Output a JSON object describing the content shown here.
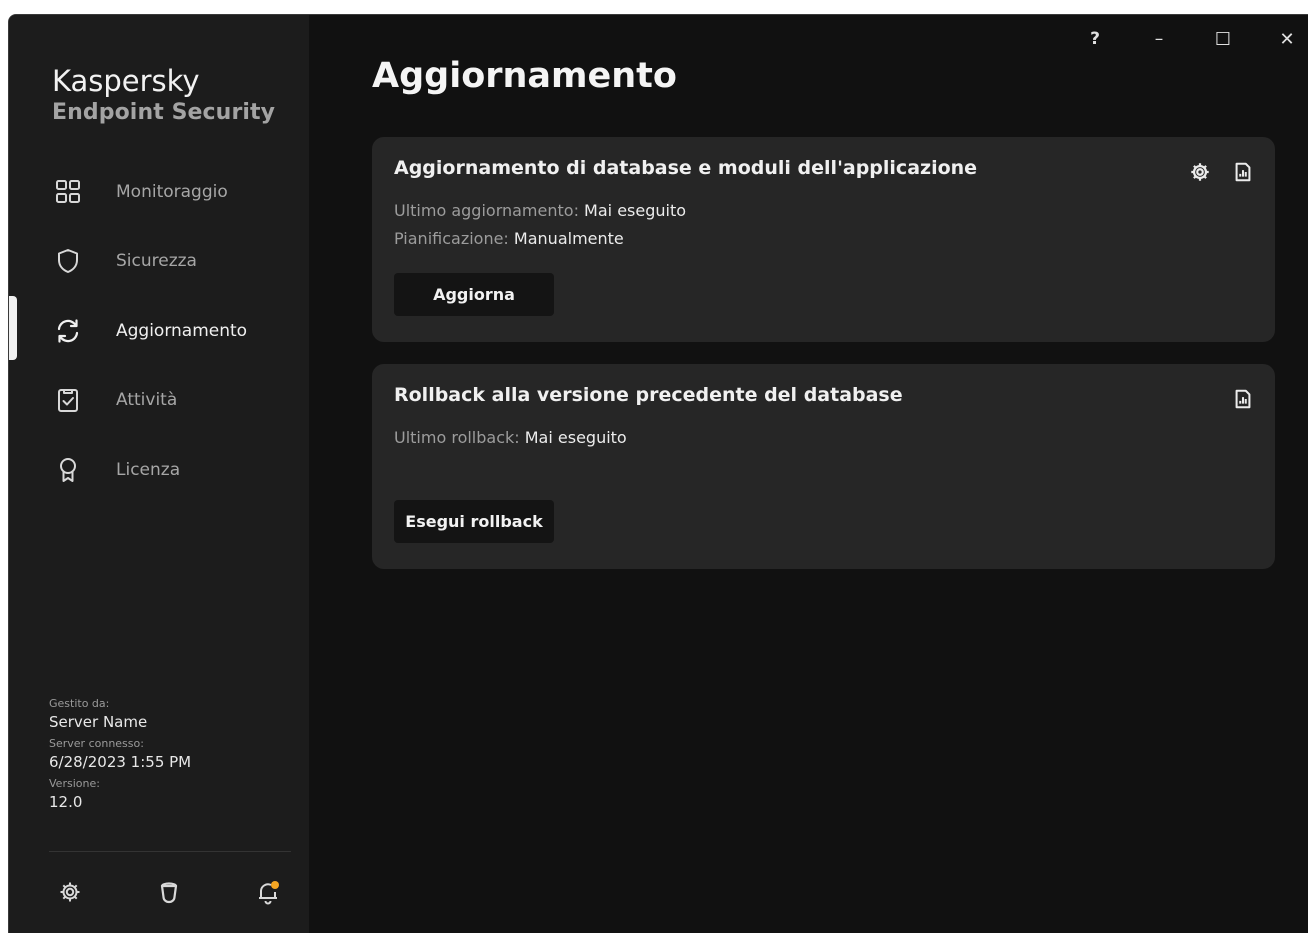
{
  "app": {
    "brand_name": "Kaspersky",
    "brand_sub": "Endpoint Security"
  },
  "window_controls": {
    "help": "?",
    "minimize": "–",
    "maximize": "☐",
    "close": "✕"
  },
  "sidebar": {
    "items": [
      {
        "label": "Monitoraggio",
        "icon": "dashboard-icon",
        "active": false
      },
      {
        "label": "Sicurezza",
        "icon": "shield-icon",
        "active": false
      },
      {
        "label": "Aggiornamento",
        "icon": "refresh-icon",
        "active": true
      },
      {
        "label": "Attività",
        "icon": "clipboard-check-icon",
        "active": false
      },
      {
        "label": "Licenza",
        "icon": "award-icon",
        "active": false
      }
    ],
    "managed": {
      "managed_by_label": "Gestito da:",
      "managed_by_value": "Server Name",
      "server_connected_label": "Server connesso:",
      "server_connected_value": "6/28/2023 1:55 PM",
      "version_label": "Versione:",
      "version_value": "12.0"
    },
    "bottom_icons": [
      "settings-icon",
      "support-icon",
      "notifications-icon"
    ],
    "notification_dot_color": "#f5a623"
  },
  "main": {
    "title": "Aggiornamento",
    "cards": [
      {
        "title": "Aggiornamento di database e moduli dell'applicazione",
        "last_update_label": "Ultimo aggiornamento:",
        "last_update_value": "Mai eseguito",
        "schedule_label": "Pianificazione:",
        "schedule_value": "Manualmente",
        "button_label": "Aggiorna",
        "icons": [
          "gear-icon",
          "report-icon"
        ]
      },
      {
        "title": "Rollback alla versione precedente del database",
        "last_rollback_label": "Ultimo rollback:",
        "last_rollback_value": "Mai eseguito",
        "button_label": "Esegui rollback",
        "icons": [
          "report-icon"
        ]
      }
    ]
  },
  "colors": {
    "background": "#111111",
    "sidebar": "#1c1c1c",
    "card": "#262626",
    "button": "#141414",
    "text_primary": "#f0f0f0",
    "text_secondary": "#9c9c9c"
  }
}
